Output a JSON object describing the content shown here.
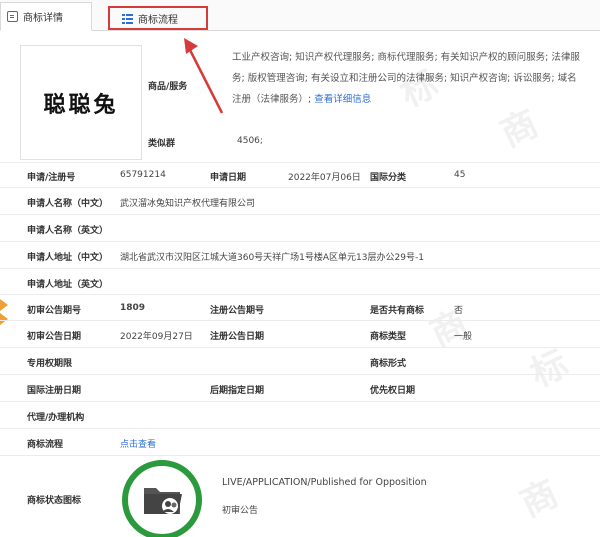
{
  "tabs": [
    {
      "label": "商标详情"
    },
    {
      "label": "商标流程"
    }
  ],
  "trademark": {
    "image_text": "聪聪兔"
  },
  "goods": {
    "label": "商品/服务",
    "text": "工业产权咨询; 知识产权代理服务; 商标代理服务; 有关知识产权的顾问服务; 法律服务; 版权管理咨询; 有关设立和注册公司的法律服务; 知识产权咨询; 诉讼服务; 域名注册（法律服务）;",
    "link": "查看详细信息"
  },
  "similar_group": {
    "label": "类似群",
    "value": "4506;"
  },
  "fields": {
    "reg_no_label": "申请/注册号",
    "reg_no": "65791214",
    "app_date_label": "申请日期",
    "app_date": "2022年07月06日",
    "intl_class_label": "国际分类",
    "intl_class": "45",
    "applicant_cn_label": "申请人名称（中文）",
    "applicant_cn": "武汉溜冰兔知识产权代理有限公司",
    "applicant_en_label": "申请人名称（英文）",
    "applicant_en": "",
    "address_cn_label": "申请人地址（中文）",
    "address_cn": "湖北省武汉市汉阳区江城大道360号天祥广场1号楼A区单元13层办公29号-1",
    "address_en_label": "申请人地址（英文）",
    "address_en": "",
    "prelim_no_label": "初审公告期号",
    "prelim_no": "1809",
    "reg_pub_no_label": "注册公告期号",
    "reg_pub_no": "",
    "shared_label": "是否共有商标",
    "shared": "否",
    "prelim_date_label": "初审公告日期",
    "prelim_date": "2022年09月27日",
    "reg_pub_date_label": "注册公告日期",
    "reg_pub_date": "",
    "tm_type_label": "商标类型",
    "tm_type": "一般",
    "exclusive_label": "专用权期限",
    "exclusive": "",
    "tm_form_label": "商标形式",
    "tm_form": "",
    "intl_reg_date_label": "国际注册日期",
    "intl_reg_date": "",
    "later_date_label": "后期指定日期",
    "later_date": "",
    "priority_date_label": "优先权日期",
    "priority_date": "",
    "agent_label": "代理/办理机构",
    "agent": "",
    "process_label": "商标流程",
    "process_link": "点击查看",
    "status_icon_label": "商标状态图标",
    "status_en": "LIVE/APPLICATION/Published for Opposition",
    "status_cn": "初审公告"
  },
  "colors": {
    "accent": "#2f6fd1",
    "highlight": "#d63b3b",
    "status": "#2a9a3c"
  }
}
